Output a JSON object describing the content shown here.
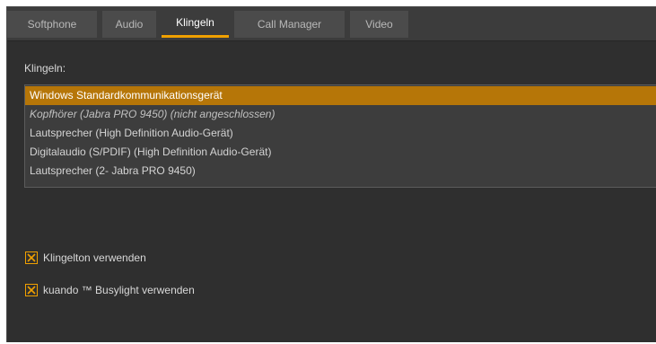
{
  "tabs": [
    {
      "label": "Softphone",
      "active": false
    },
    {
      "label": "Audio",
      "active": false
    },
    {
      "label": "Klingeln",
      "active": true
    },
    {
      "label": "Call Manager",
      "active": false
    },
    {
      "label": "Video",
      "active": false
    }
  ],
  "ringing": {
    "label": "Klingeln:",
    "devices": [
      {
        "label": "Windows Standardkommunikationsgerät",
        "selected": true,
        "disconnected": false
      },
      {
        "label": "Kopfhörer (Jabra PRO 9450) (nicht angeschlossen)",
        "selected": false,
        "disconnected": true
      },
      {
        "label": "Lautsprecher (High Definition Audio-Gerät)",
        "selected": false,
        "disconnected": false
      },
      {
        "label": "Digitalaudio (S/PDIF) (High Definition Audio-Gerät)",
        "selected": false,
        "disconnected": false
      },
      {
        "label": "Lautsprecher (2- Jabra PRO 9450)",
        "selected": false,
        "disconnected": false
      }
    ]
  },
  "options": {
    "ringtone": {
      "label": "Klingelton verwenden",
      "checked": true
    },
    "busylight": {
      "label": "kuando ™ Busylight verwenden",
      "checked": true
    }
  },
  "colors": {
    "accent": "#f0a000",
    "selection": "#b67608",
    "panel_bg": "#2f2f2f",
    "tab_bg": "#4b4b4b"
  }
}
